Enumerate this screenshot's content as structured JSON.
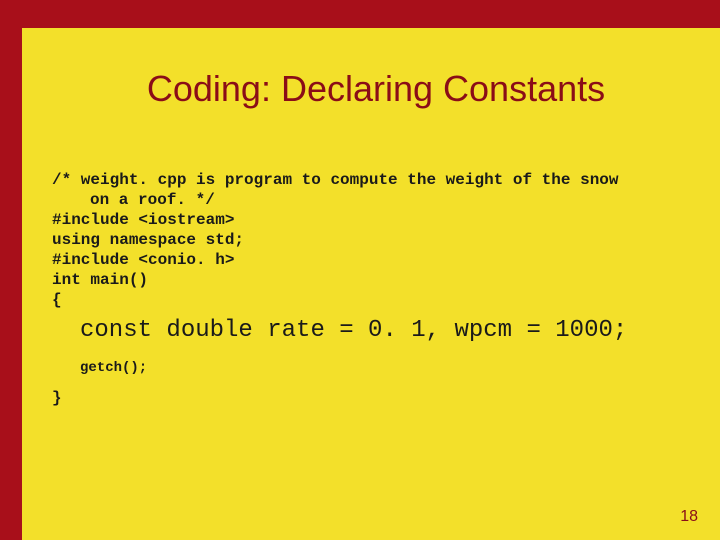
{
  "slide": {
    "title": "Coding: Declaring Constants",
    "code": {
      "c1": "/* weight. cpp is program to compute the weight of the snow",
      "c2": "on a roof. */",
      "l1": "#include <iostream>",
      "l2": "using namespace std;",
      "l3": "#include <conio. h>",
      "l4": "int main()",
      "l5": "{",
      "big": "const double rate = 0. 1, wpcm = 1000;",
      "g1": "getch();",
      "close": "}"
    },
    "page": "18"
  }
}
